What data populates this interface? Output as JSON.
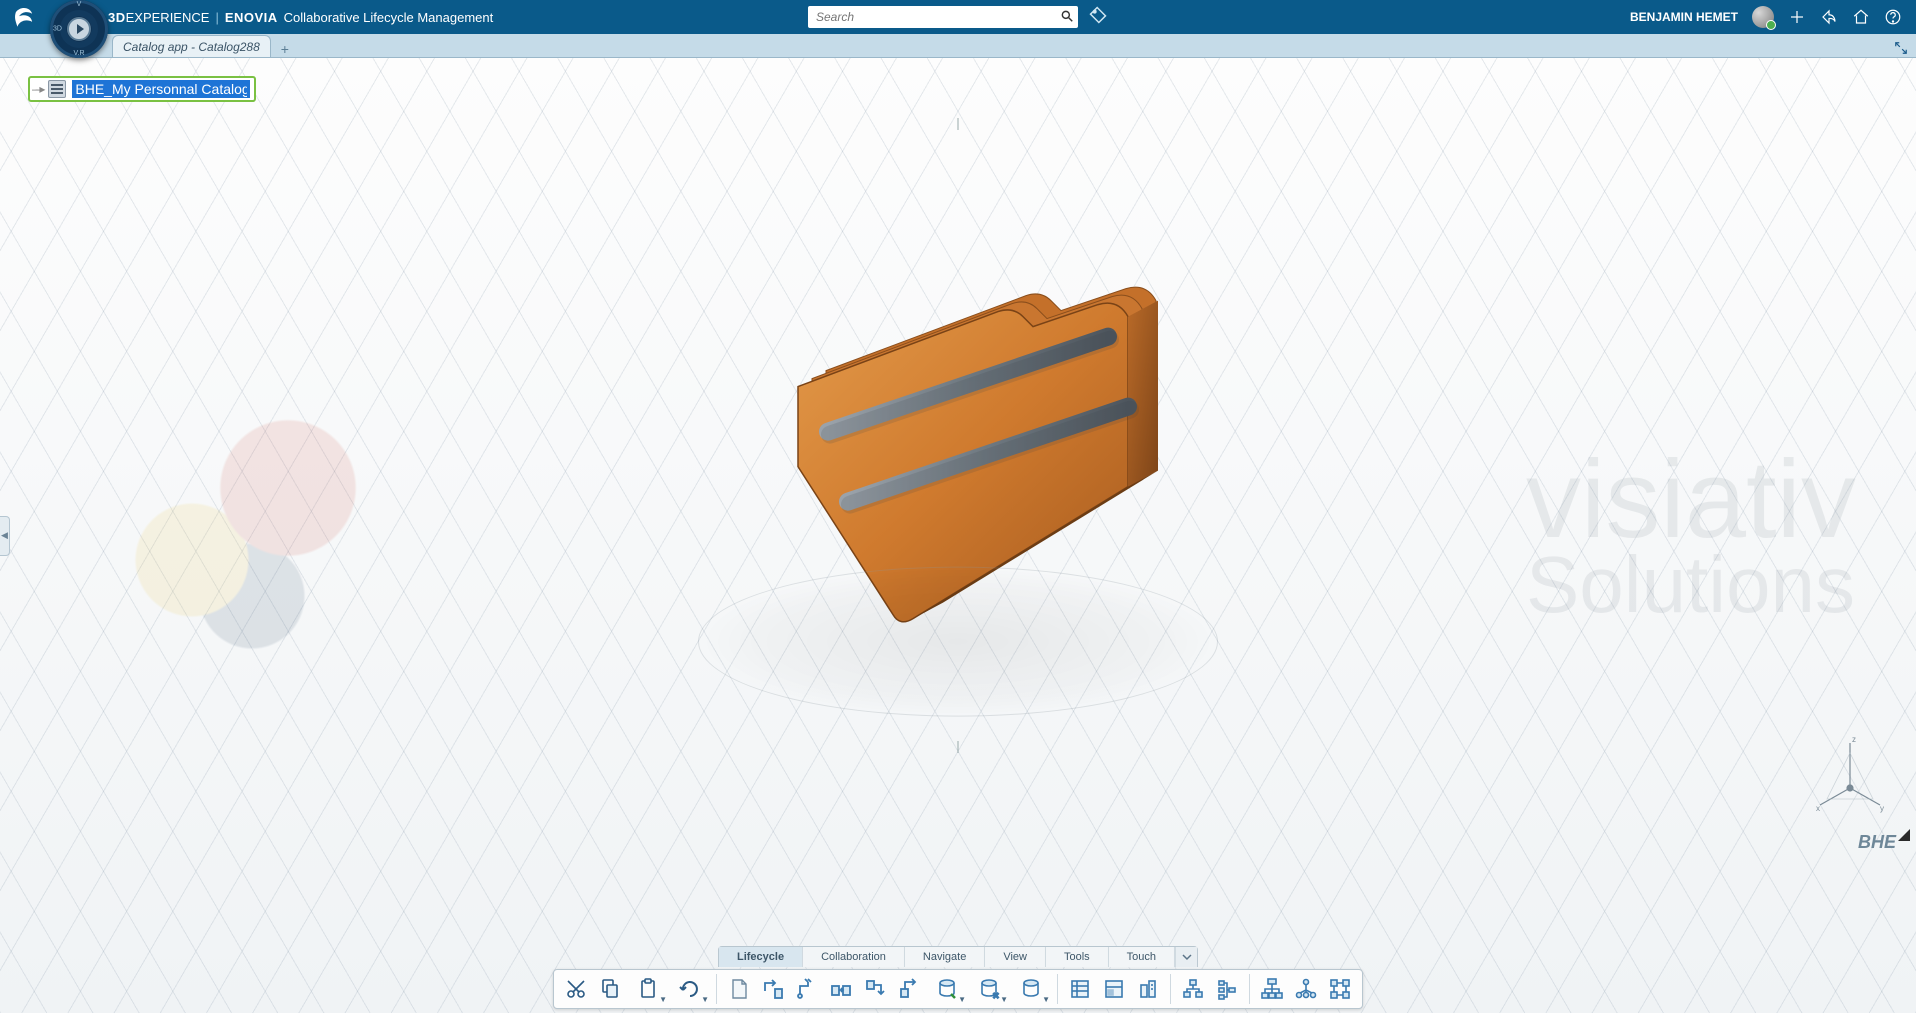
{
  "header": {
    "brand_bold": "3D",
    "brand_thin": "EXPERIENCE",
    "brand_product": "ENOVIA",
    "brand_sub": "Collaborative Lifecycle Management",
    "search_placeholder": "Search",
    "user_name": "BENJAMIN HEMET"
  },
  "compass": {
    "labels": {
      "left": "3D",
      "top": "V",
      "bottom": "V.R"
    }
  },
  "tabs": {
    "items": [
      {
        "label": "Catalog app - Catalog288"
      }
    ]
  },
  "tree": {
    "editing_value": "BHE_My Personnal Catalog"
  },
  "watermark": {
    "line1": "visiativ",
    "line2": "Solutions"
  },
  "viewport": {
    "user_tag": "BHE"
  },
  "cmd_tabs": {
    "items": [
      "Lifecycle",
      "Collaboration",
      "Navigate",
      "View",
      "Tools",
      "Touch"
    ],
    "active_index": 0
  },
  "toolbar": {
    "group_edit": [
      "cut",
      "copy",
      "paste",
      "undo"
    ],
    "group_lifecycle": [
      "new-sheet",
      "revise",
      "new-branch",
      "duplicate",
      "replace-by-revision",
      "replace-by-latest",
      "database-save",
      "database-dropdown",
      "database-actions"
    ],
    "group_views": [
      "list-view",
      "thumbnail-view",
      "wide-view"
    ],
    "group_structure": [
      "tree-small",
      "tree-compact",
      "spacer",
      "tree-large",
      "tree-network",
      "tree-grid"
    ]
  },
  "colors": {
    "header_bg": "#005686",
    "accent": "#1e74d6",
    "highlight_border": "#7ac142",
    "folder": "#d07a2c"
  }
}
